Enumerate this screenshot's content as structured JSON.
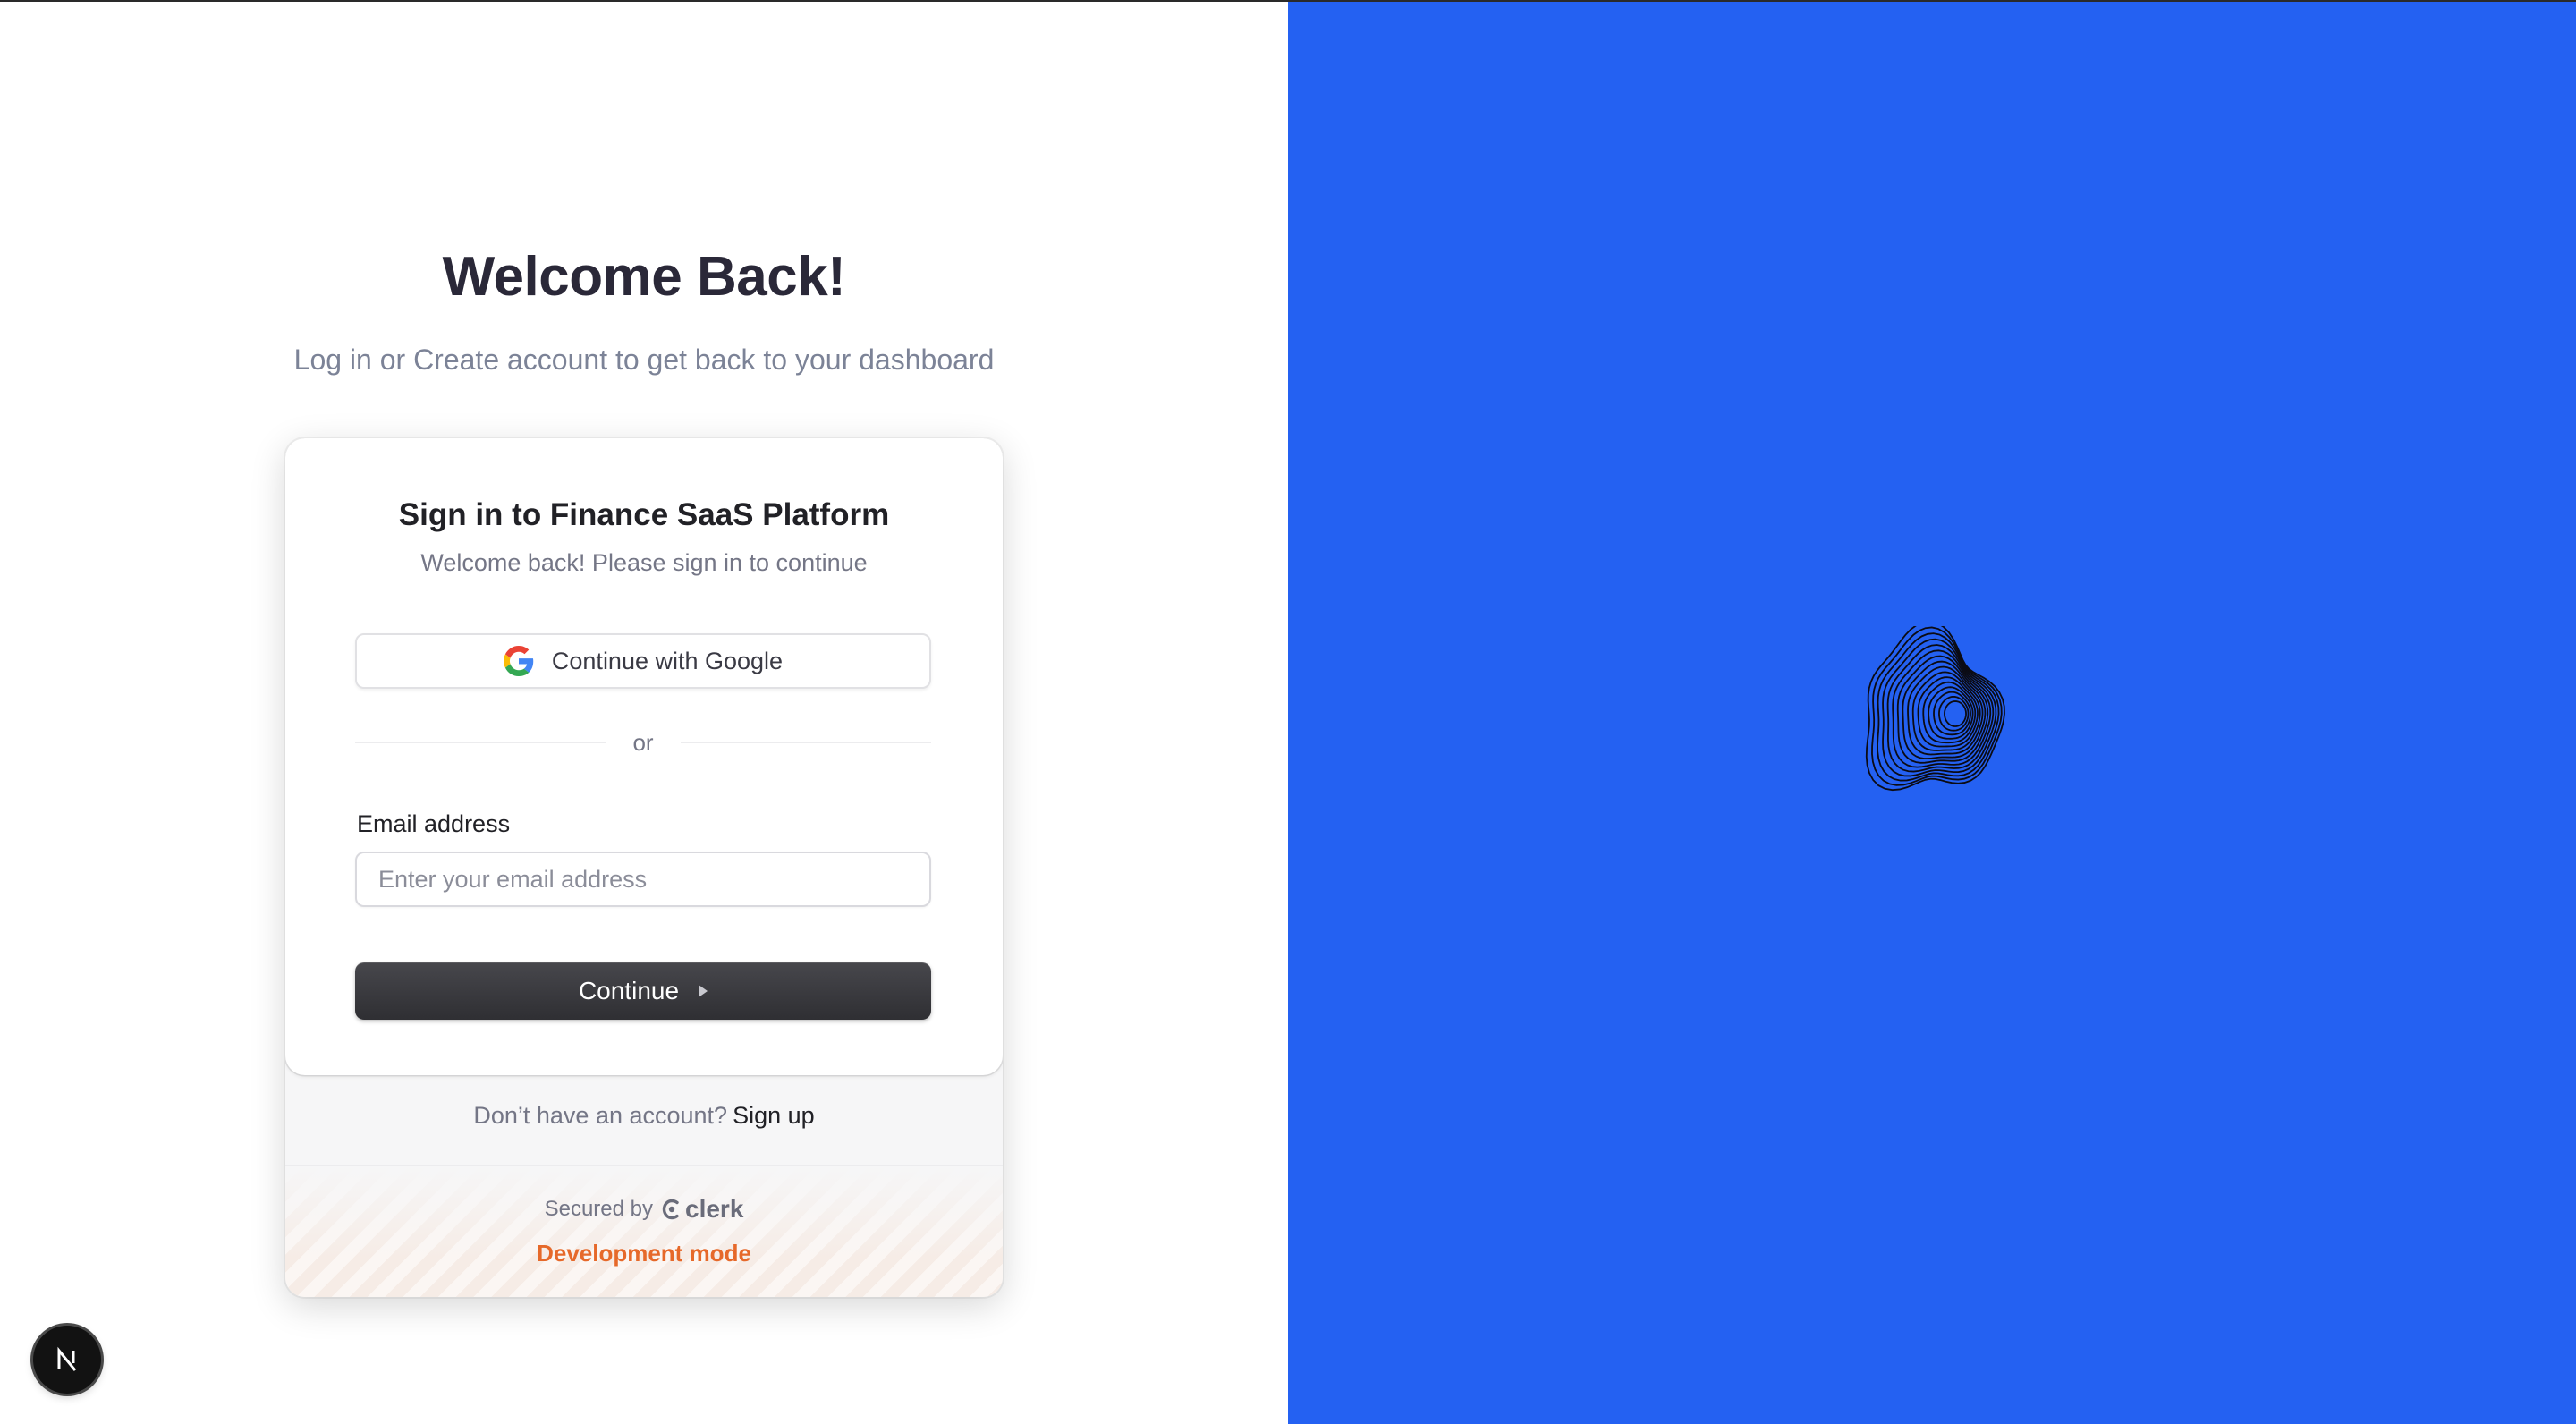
{
  "page": {
    "heading": "Welcome Back!",
    "subheading": "Log in or Create account to get back to your dashboard"
  },
  "signin_card": {
    "title": "Sign in to Finance SaaS Platform",
    "subtitle": "Welcome back! Please sign in to continue",
    "google_button_label": "Continue with Google",
    "divider_text": "or",
    "email_label": "Email address",
    "email_placeholder": "Enter your email address",
    "email_value": "",
    "continue_button_label": "Continue"
  },
  "footer": {
    "no_account_text": "Don’t have an account?",
    "signup_link": "Sign up",
    "secured_by": "Secured by",
    "clerk_brand": "clerk",
    "dev_mode": "Development mode"
  },
  "icons": {
    "google": "google-icon",
    "continue_arrow": "play-arrow-icon",
    "clerk": "clerk-logo-icon",
    "nextjs": "nextjs-icon",
    "brand_logo": "abstract-logo-icon"
  },
  "colors": {
    "right_panel": "#2461f2",
    "heading": "#2a2838",
    "dev_mode": "#e6692a",
    "continue_button": "#2f2f33"
  }
}
